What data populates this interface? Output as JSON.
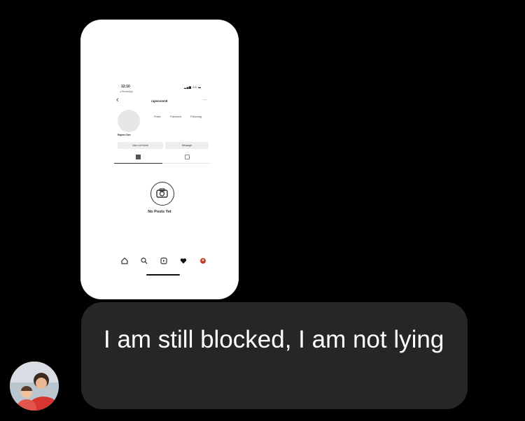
{
  "screenshot": {
    "status_time": "12:10",
    "status_sub": "◂ WhatsApp",
    "status_icons": "▂▄▆ 4G ▬",
    "username": "rajeevsen9",
    "stats": [
      "Posts",
      "Followers",
      "Following"
    ],
    "display_name": "Rajeev Sen",
    "btn_primary": "User not found",
    "btn_secondary": "Message",
    "empty_text": "No Posts Yet"
  },
  "message": {
    "text": "I am still blocked, I am not lying"
  },
  "colors": {
    "background": "#000000",
    "bubble": "#262626",
    "text": "#ffffff"
  }
}
